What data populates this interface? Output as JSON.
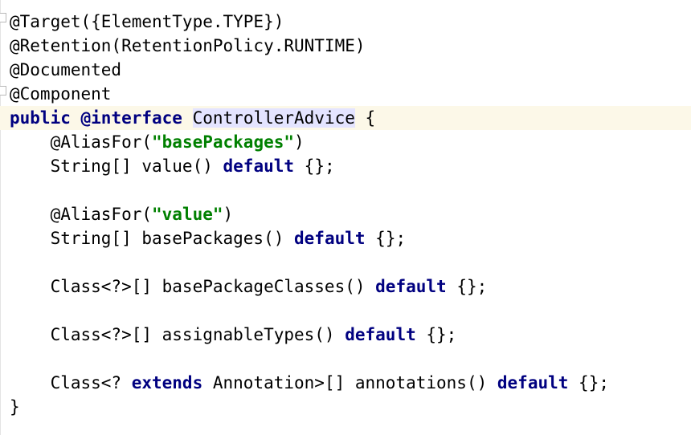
{
  "editor": {
    "lines": [
      {
        "parts": [
          {
            "t": "@Target({ElementType.TYPE})",
            "c": "ann"
          }
        ]
      },
      {
        "parts": [
          {
            "t": "@Retention(RetentionPolicy.RUNTIME)",
            "c": "ann"
          }
        ]
      },
      {
        "parts": [
          {
            "t": "@Documented",
            "c": "ann"
          }
        ]
      },
      {
        "parts": [
          {
            "t": "@Component",
            "c": "ann"
          }
        ]
      },
      {
        "current": true,
        "parts": [
          {
            "t": "public",
            "c": "kw"
          },
          {
            "t": " ",
            "c": ""
          },
          {
            "t": "@interface",
            "c": "kw"
          },
          {
            "t": " ",
            "c": ""
          },
          {
            "t": "ControllerAdvice",
            "c": "ident-hl"
          },
          {
            "t": " {",
            "c": ""
          }
        ]
      },
      {
        "parts": [
          {
            "t": "    @AliasFor(",
            "c": ""
          },
          {
            "t": "\"basePackages\"",
            "c": "str"
          },
          {
            "t": ")",
            "c": ""
          }
        ]
      },
      {
        "parts": [
          {
            "t": "    String[] value() ",
            "c": ""
          },
          {
            "t": "default",
            "c": "kw"
          },
          {
            "t": " {};",
            "c": ""
          }
        ]
      },
      {
        "parts": [
          {
            "t": "",
            "c": ""
          }
        ]
      },
      {
        "parts": [
          {
            "t": "    @AliasFor(",
            "c": ""
          },
          {
            "t": "\"value\"",
            "c": "str"
          },
          {
            "t": ")",
            "c": ""
          }
        ]
      },
      {
        "parts": [
          {
            "t": "    String[] basePackages() ",
            "c": ""
          },
          {
            "t": "default",
            "c": "kw"
          },
          {
            "t": " {};",
            "c": ""
          }
        ]
      },
      {
        "parts": [
          {
            "t": "",
            "c": ""
          }
        ]
      },
      {
        "parts": [
          {
            "t": "    Class<?>[] basePackageClasses() ",
            "c": ""
          },
          {
            "t": "default",
            "c": "kw"
          },
          {
            "t": " {};",
            "c": ""
          }
        ]
      },
      {
        "parts": [
          {
            "t": "",
            "c": ""
          }
        ]
      },
      {
        "parts": [
          {
            "t": "    Class<?>[] assignableTypes() ",
            "c": ""
          },
          {
            "t": "default",
            "c": "kw"
          },
          {
            "t": " {};",
            "c": ""
          }
        ]
      },
      {
        "parts": [
          {
            "t": "",
            "c": ""
          }
        ]
      },
      {
        "parts": [
          {
            "t": "    Class<? ",
            "c": ""
          },
          {
            "t": "extends",
            "c": "kw"
          },
          {
            "t": " Annotation>[] annotations() ",
            "c": ""
          },
          {
            "t": "default",
            "c": "kw"
          },
          {
            "t": " {};",
            "c": ""
          }
        ]
      },
      {
        "parts": [
          {
            "t": "}",
            "c": ""
          }
        ]
      }
    ]
  },
  "colors": {
    "keyword": "#000080",
    "string": "#008000",
    "current_line": "#fcf8e8",
    "identifier_highlight": "#e4e4ff"
  }
}
